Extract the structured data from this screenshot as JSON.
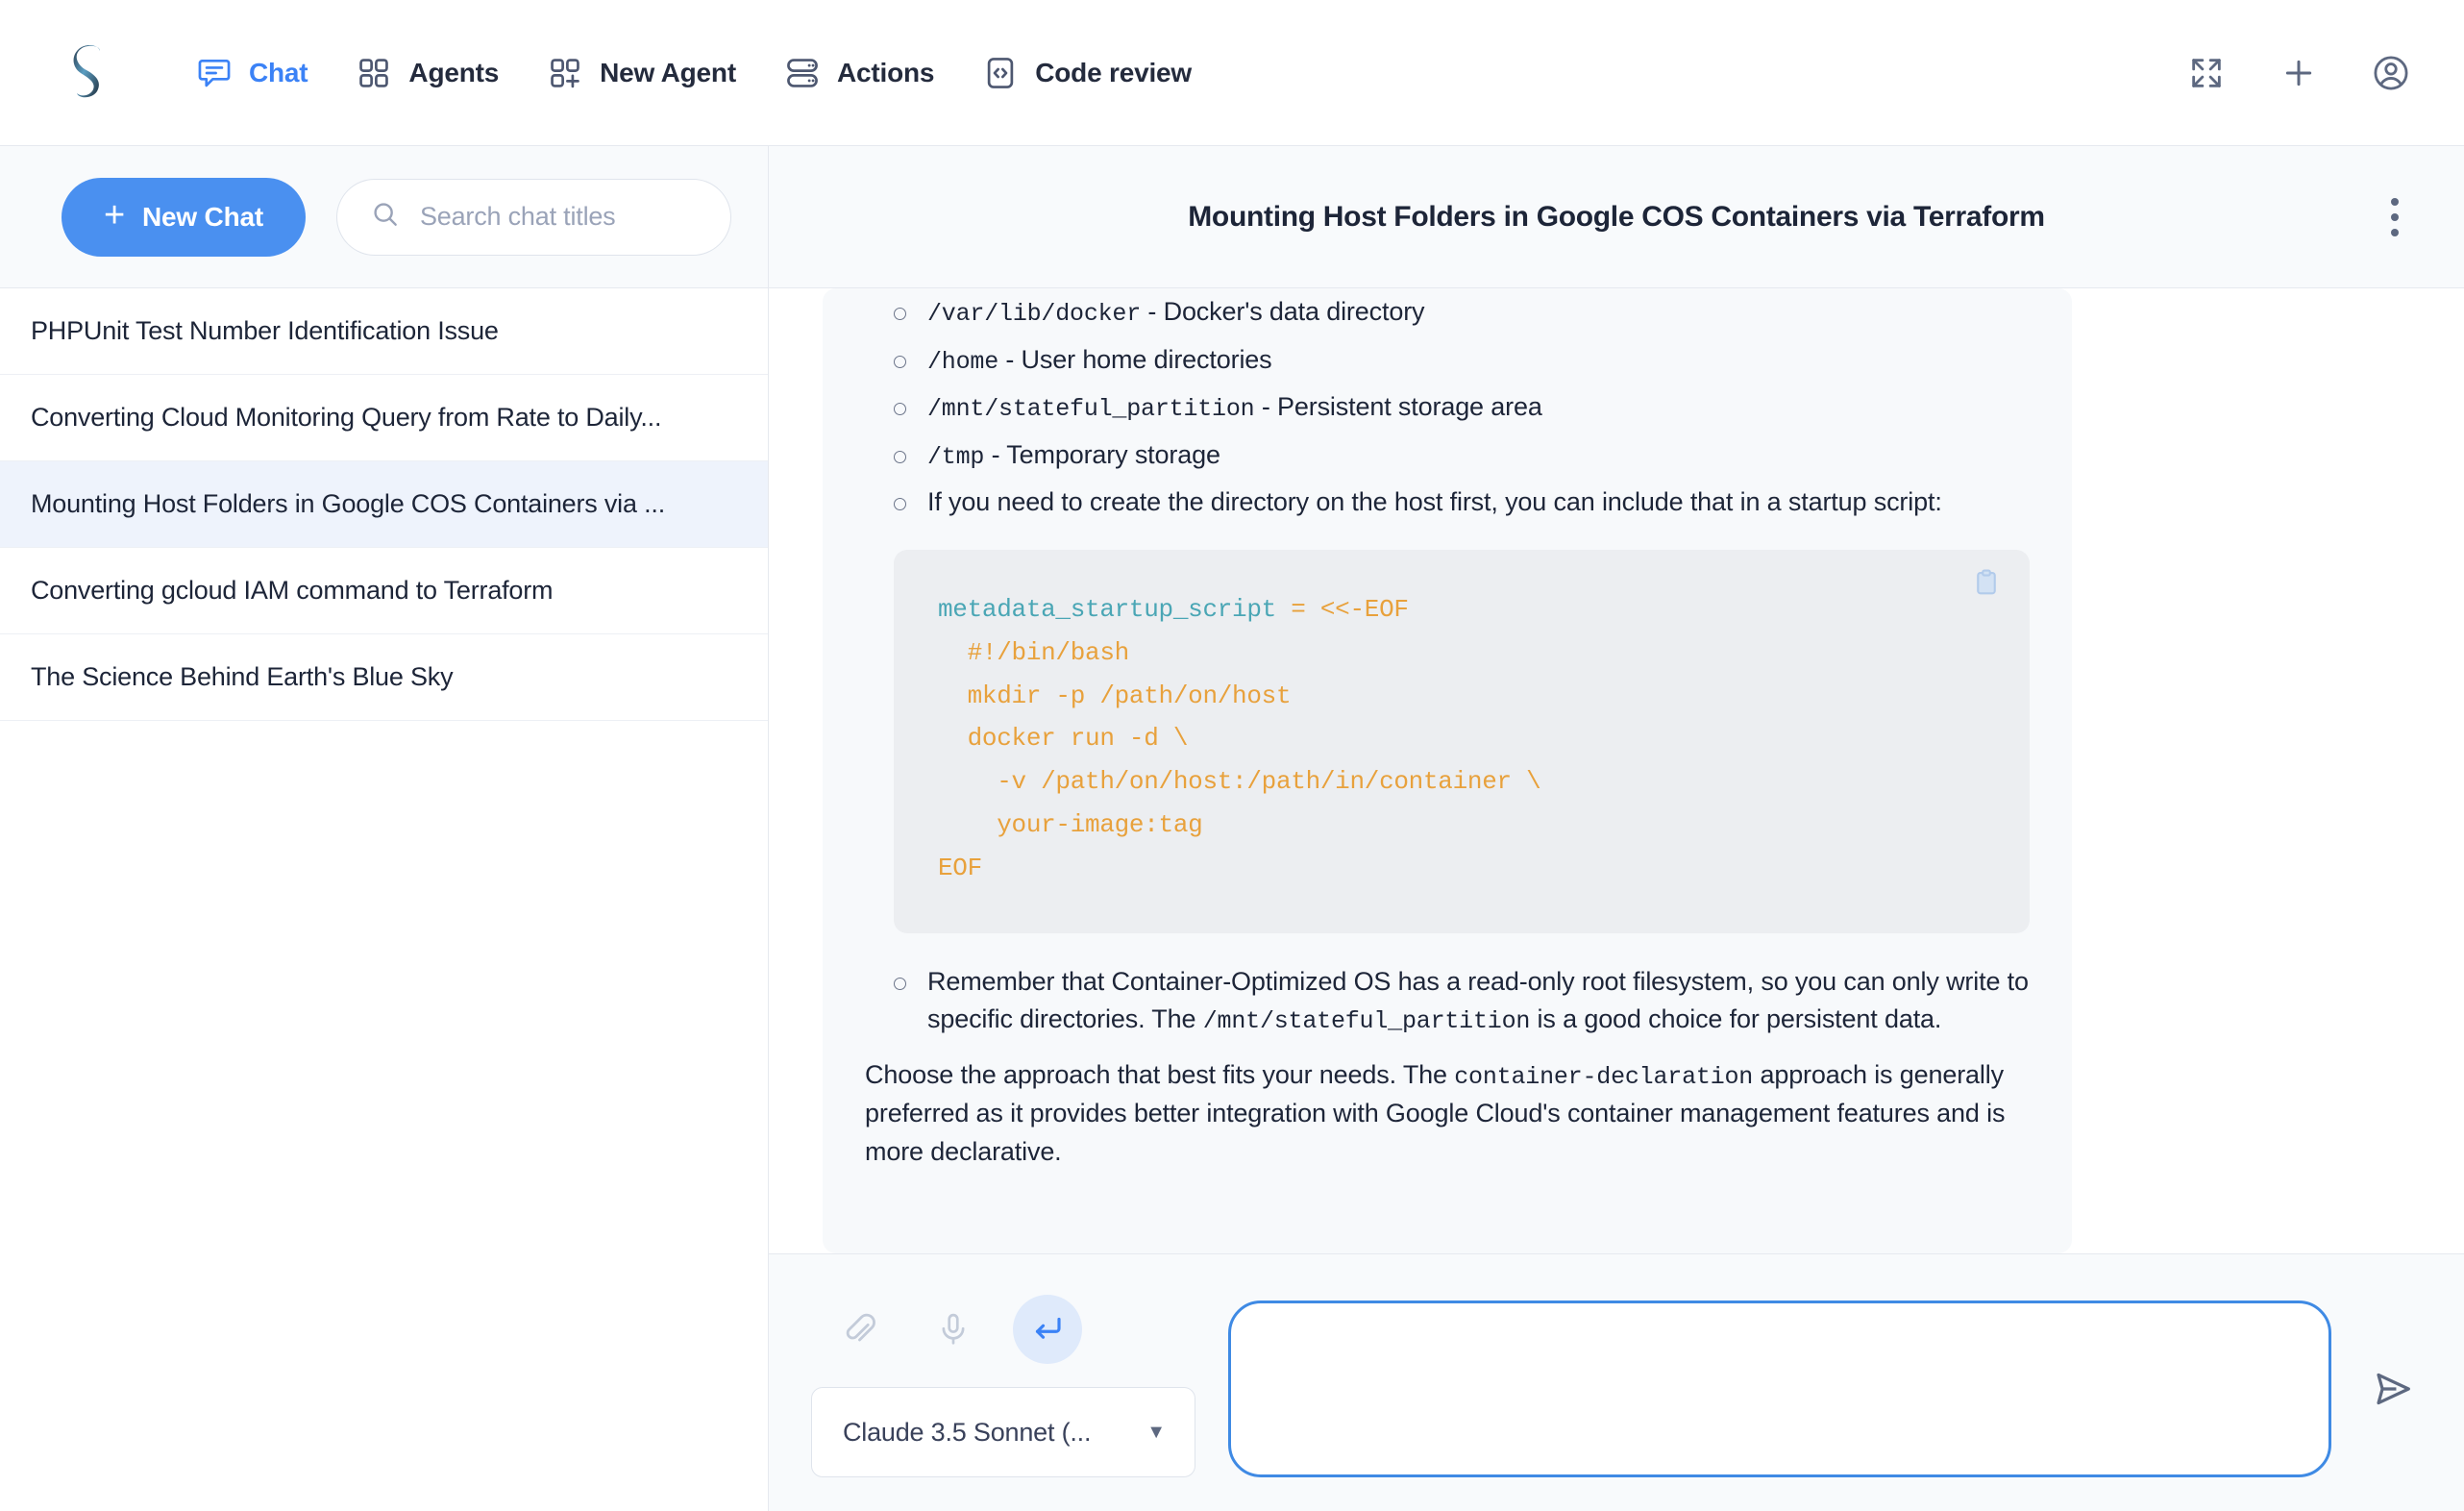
{
  "app": {
    "logo_alt": "stylized-s-logo"
  },
  "topnav": {
    "items": [
      {
        "label": "Chat",
        "icon": "chat-bubble-icon",
        "active": true
      },
      {
        "label": "Agents",
        "icon": "grid-four-squares-icon",
        "active": false
      },
      {
        "label": "New Agent",
        "icon": "grid-plus-icon",
        "active": false
      },
      {
        "label": "Actions",
        "icon": "server-stack-icon",
        "active": false
      },
      {
        "label": "Code review",
        "icon": "code-brackets-icon",
        "active": false
      }
    ],
    "right_actions": [
      {
        "name": "expand-fullscreen-icon"
      },
      {
        "name": "plus-icon"
      },
      {
        "name": "user-account-icon"
      }
    ]
  },
  "sidebar": {
    "new_chat_label": "New Chat",
    "new_chat_plus": "+",
    "search": {
      "placeholder": "Search chat titles",
      "value": "",
      "icon": "search-icon"
    },
    "chats": [
      {
        "title": "PHPUnit Test Number Identification Issue",
        "selected": false
      },
      {
        "title": "Converting Cloud Monitoring Query from Rate to Daily...",
        "selected": false
      },
      {
        "title": "Mounting Host Folders in Google COS Containers via ...",
        "selected": true
      },
      {
        "title": "Converting gcloud IAM command to Terraform",
        "selected": false
      },
      {
        "title": "The Science Behind Earth's Blue Sky",
        "selected": false
      }
    ]
  },
  "chat": {
    "title": "Mounting Host Folders in Google COS Containers via Terraform",
    "menu_icon": "kebab-menu-icon",
    "message": {
      "directory_list": [
        {
          "code": "/var/lib/docker",
          "text": " - Docker's data directory"
        },
        {
          "code": "/home",
          "text": " - User home directories"
        },
        {
          "code": "/mnt/stateful_partition",
          "text": " - Persistent storage area"
        },
        {
          "code": "/tmp",
          "text": " - Temporary storage"
        }
      ],
      "startup_note": "If you need to create the directory on the host first, you can include that in a startup script:",
      "code_block": {
        "copy_icon": "clipboard-copy-icon",
        "identifier": "metadata_startup_script",
        "rest_first_line": " = <<-EOF",
        "body": "  #!/bin/bash\n  mkdir -p /path/on/host\n  docker run -d \\\n    -v /path/on/host:/path/in/container \\\n    your-image:tag\nEOF"
      },
      "readonly_note_a": "Remember that Container-Optimized OS has a read-only root filesystem, so you can only write to specific directories. The ",
      "readonly_note_code": "/mnt/stateful_partition",
      "readonly_note_b": " is a good choice for persistent data.",
      "closing_a": "Choose the approach that best fits your needs. The ",
      "closing_code": "container-declaration",
      "closing_b": " approach is generally preferred as it provides better integration with Google Cloud's container management features and is more declarative."
    }
  },
  "composer": {
    "tools": [
      {
        "name": "attach-paperclip-icon",
        "active": false
      },
      {
        "name": "microphone-icon",
        "active": false
      },
      {
        "name": "enter-return-icon",
        "active": true
      }
    ],
    "model": {
      "label": "Claude 3.5 Sonnet (...",
      "caret": "▼"
    },
    "input": {
      "value": "",
      "placeholder": ""
    },
    "send_icon": "send-paper-plane-icon"
  },
  "colors": {
    "accent_blue": "#3b82f6",
    "button_blue": "#4a90f0",
    "text_dark": "#1d2538",
    "code_orange": "#e8a13c",
    "code_teal": "#4aa6b5",
    "selected_row": "#eef3fc"
  }
}
